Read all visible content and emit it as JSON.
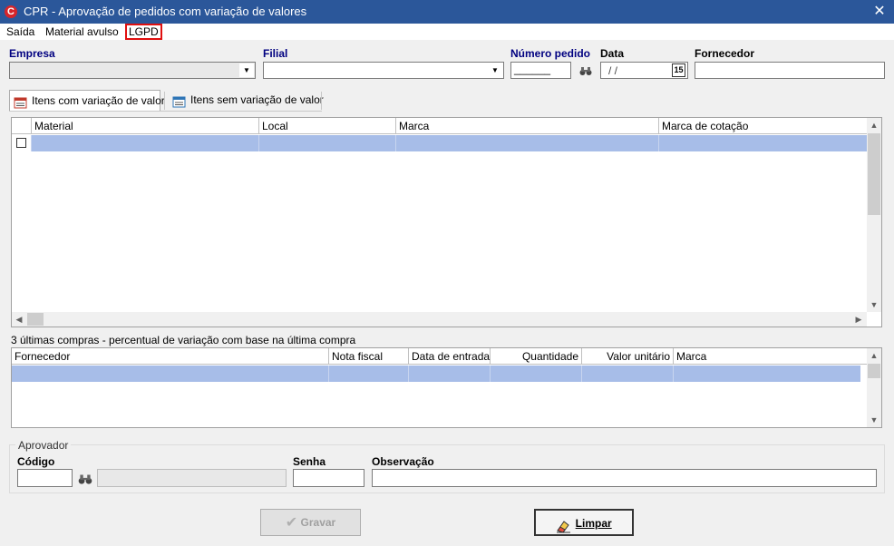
{
  "window": {
    "title": "CPR - Aprovação de pedidos com variação de valores",
    "close_glyph": "✕",
    "logo_letter": "C"
  },
  "menu": {
    "items": [
      "Saída",
      "Material avulso",
      "LGPD"
    ]
  },
  "filters": {
    "empresa": {
      "label": "Empresa",
      "value": ""
    },
    "filial": {
      "label": "Filial",
      "value": ""
    },
    "numero_pedido": {
      "label": "Número pedido",
      "value": "______"
    },
    "data": {
      "label": "Data",
      "value": "/ /",
      "calendar_day": "15"
    },
    "fornecedor": {
      "label": "Fornecedor",
      "value": ""
    }
  },
  "tabs": [
    {
      "label": "Itens com variação de valor",
      "active": true,
      "icon": "calendar-list-icon"
    },
    {
      "label": "Itens sem variação de valor",
      "active": false,
      "icon": "calendar-list-icon"
    }
  ],
  "items_grid": {
    "columns": [
      "Material",
      "Local",
      "Marca",
      "Marca de cotação"
    ],
    "rows": [
      {
        "checked": false,
        "cells": [
          "",
          "",
          "",
          ""
        ]
      }
    ]
  },
  "history": {
    "caption": "3 últimas compras - percentual de variação com base na última compra",
    "columns": [
      "Fornecedor",
      "Nota fiscal",
      "Data de entrada",
      "Quantidade",
      "Valor unitário",
      "Marca"
    ],
    "rows": [
      {
        "cells": [
          "",
          "",
          "",
          "",
          "",
          ""
        ]
      }
    ]
  },
  "aprovador": {
    "group_label": "Aprovador",
    "codigo_label": "Código",
    "codigo_value": "",
    "nome_value": "",
    "senha_label": "Senha",
    "observacao_label": "Observação"
  },
  "buttons": {
    "gravar": "Gravar",
    "limpar": "Limpar"
  },
  "colors": {
    "titlebar": "#2b579a",
    "selection": "#a7bde8",
    "label_blue": "#000080",
    "highlight_box": "#e01010"
  }
}
